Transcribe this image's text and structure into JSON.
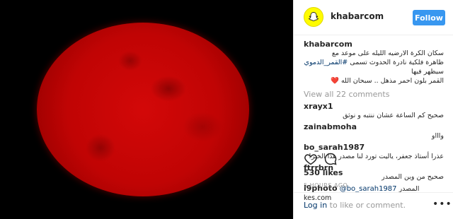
{
  "post": {
    "username": "khabarcom",
    "follow_label": "Follow",
    "caption_user": "khabarcom",
    "caption_text_1": "سكان الكرة الارضيه الليله على موعد مع",
    "caption_text_2a": "ظاهرة فلكية نادرة الحدوث تسمى ",
    "caption_hashtag": "#القمر_الدموي",
    "caption_text_2b": " سيظهر فيها",
    "caption_text_3": "القمر بلون احمر مذهل .. سبحان الله ❤️",
    "view_all": "View all 22 comments",
    "comments": [
      {
        "user": "xrayx1",
        "text": "صحيح كم الساعة عشان ننتبه و نوثق"
      },
      {
        "user": "zainabmoha",
        "text": "واااو"
      },
      {
        "user": "bo_sarah1987",
        "text": "عذرا أستاذ جعفر، ياليت تورد لنا مصدر هذا الخبر!"
      },
      {
        "user": "ftrrbrn",
        "text": "صحيح من وين المصدر"
      }
    ],
    "last_comment_user": "l9photo",
    "last_comment_mention": "@bo_sarah1987",
    "last_comment_text": " المصدر kes.com",
    "likes": "530 likes",
    "time": "5 HOURS AGO",
    "login_link": "Log in",
    "login_rest": " to like or comment.",
    "more_label": "•••"
  },
  "icons": {
    "avatar": "snapchat-ghost-icon",
    "like": "heart-icon",
    "comment": "comment-bubble-icon",
    "more": "more-options-icon"
  },
  "colors": {
    "follow_button": "#3897f0",
    "avatar_bg": "#fffc00",
    "moon_red": "#c00404"
  }
}
